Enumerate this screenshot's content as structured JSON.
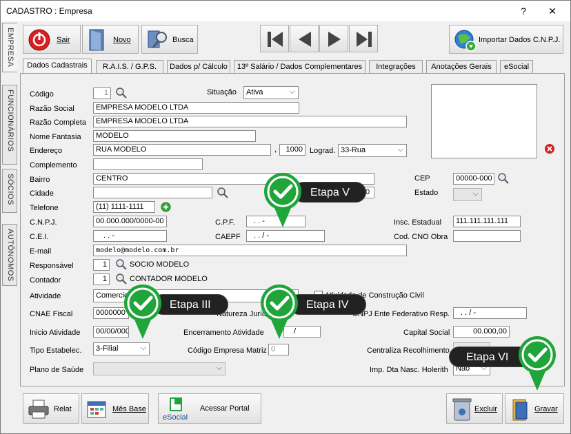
{
  "window": {
    "title": "CADASTRO : Empresa",
    "help": "?",
    "close": "✕"
  },
  "side_tabs": [
    "EMPRESA",
    "FUNCIONÁRIOS",
    "SÓCIOS",
    "AUTÔNOMOS"
  ],
  "toolbar": {
    "sair": "Sair",
    "novo": "Novo",
    "busca": "Busca",
    "importar": "Importar Dados C.N.P.J."
  },
  "tabs": [
    "Dados Cadastrais",
    "R.A.I.S. / G.P.S.",
    "Dados p/ Cálculo",
    "13º Salário / Dados Complementares",
    "Integrações",
    "Anotações Gerais",
    "eSocial"
  ],
  "form": {
    "codigo_label": "Código",
    "codigo": "1",
    "situacao_label": "Situação",
    "situacao": "Ativa",
    "razao_social_label": "Razão Social",
    "razao_social": "EMPRESA MODELO LTDA",
    "razao_completa_label": "Razão Completa",
    "razao_completa": "EMPRESA MODELO LTDA",
    "nome_fantasia_label": "Nome Fantasia",
    "nome_fantasia": "MODELO",
    "endereco_label": "Endereço",
    "endereco": "RUA MODELO",
    "numero_sep": ",",
    "numero": "1000",
    "lograd_label": "Lograd.",
    "lograd": "33-Rua",
    "complemento_label": "Complemento",
    "bairro_label": "Bairro",
    "bairro": "CENTRO",
    "cep_label": "CEP",
    "cep": "00000-000",
    "cidade_label": "Cidade",
    "cidade_partial": "0",
    "estado_label": "Estado",
    "telefone_label": "Telefone",
    "telefone": "(11)  1111-1111",
    "cnpj_label": "C.N.P.J.",
    "cnpj": "00.000.000/0000-00",
    "cpf_label": "C.P.F.",
    "cpf": ".     .     -",
    "insc_estadual_label": "Insc. Estadual",
    "insc_estadual": "111.111.111.111",
    "cei_label": "C.E.I.",
    "cei": ".         .         -",
    "caepf_label": "CAEPF",
    "caepf": ".     .     /     -",
    "cno_label": "Cod. CNO Obra",
    "email_label": "E-mail",
    "email": "modelo@modelo.com.br",
    "responsavel_label": "Responsável",
    "responsavel_cod": "1",
    "responsavel_nome": "SOCIO MODELO",
    "contador_label": "Contador",
    "contador_cod": "1",
    "contador_nome": "CONTADOR MODELO",
    "atividade_label": "Atividade",
    "atividade": "Comercio",
    "atividade_constr_label": "Atividade de Construção Civil",
    "cnae_label": "CNAE Fiscal",
    "cnae": "0000000",
    "natureza_label": "Natureza Jurídica",
    "ente_label": "CNPJ Ente Federativo Resp.",
    "ente": ".     .     /     -",
    "inicio_label": "Inicio Atividade",
    "inicio": "00/00/0000",
    "encerramento_label": "Encerramento Atividade",
    "encerramento": "/",
    "capital_label": "Capital Social",
    "capital": "00.000,00",
    "tipo_estab_label": "Tipo Estabelec.",
    "tipo_estab": "3-Filial",
    "cod_matriz_label": "Código Empresa Matriz",
    "cod_matriz": "0",
    "centraliza_label": "Centraliza Recolhimento",
    "plano_label": "Plano de Saúde",
    "imp_dta_label": "Imp. Dta Nasc. Holerith",
    "imp_dta": "Não"
  },
  "callouts": [
    "Etapa V",
    "Etapa III",
    "Etapa IV",
    "Etapa VI"
  ],
  "bottom": {
    "relat": "Relat",
    "mes_base": "Mês Base",
    "esocial": "eSocial",
    "acessar": "Acessar Portal",
    "excluir": "Excluir",
    "gravar": "Gravar"
  },
  "colors": {
    "callout_green": "#1fa53a",
    "accent_red": "#d42020"
  }
}
